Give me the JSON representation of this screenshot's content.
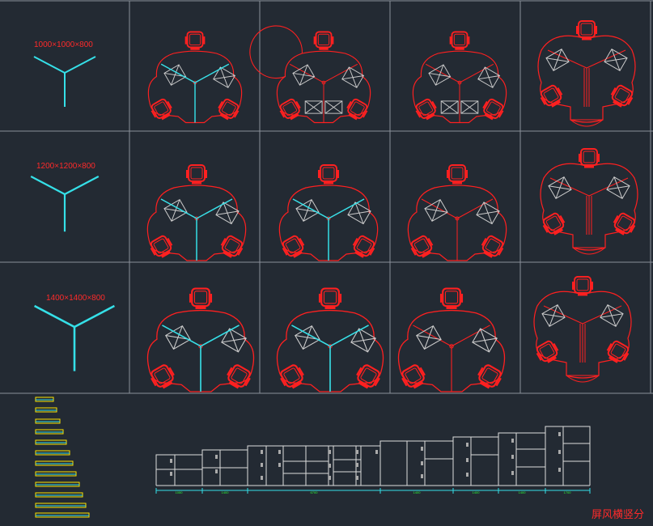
{
  "app": "CAD drawing viewer",
  "grid": {
    "rows": 3,
    "cols": 5
  },
  "rows": [
    {
      "size_label": "1000×1000×800"
    },
    {
      "size_label": "1200×1200×800"
    },
    {
      "size_label": "1400×1400×800"
    }
  ],
  "bottom": {
    "caption": "屏风横竖分",
    "dimension_labels": [
      "1050",
      "1400",
      "6700",
      "1400",
      "1400",
      "1400",
      "1700"
    ]
  },
  "colors": {
    "background": "#232a33",
    "grid": "#8a9099",
    "furniture": "#ff2020",
    "screen": "#35e0e8",
    "label": "#ff2a2a",
    "cabinet": "#dddddd",
    "dimension": "#2bff3a",
    "yellow": "#ffe600"
  }
}
